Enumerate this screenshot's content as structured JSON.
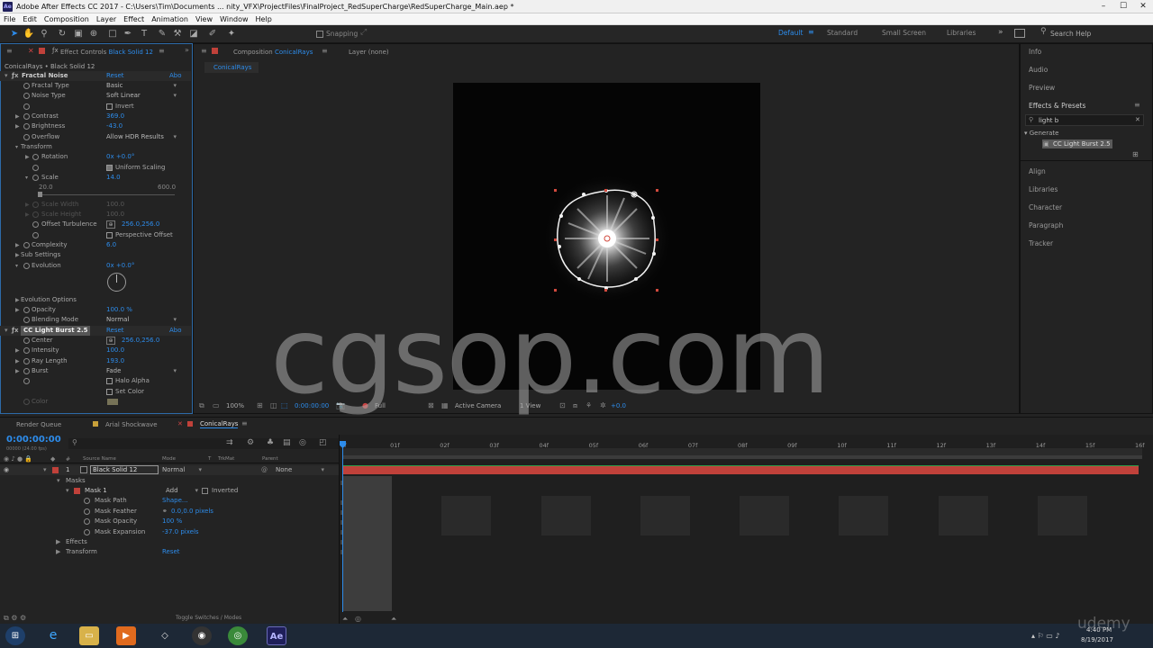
{
  "window": {
    "title": "Adobe After Effects CC 2017 - C:\\Users\\Tim\\Documents ... nity_VFX\\ProjectFiles\\FinalProject_RedSuperCharge\\RedSuperCharge_Main.aep *"
  },
  "menu": [
    "File",
    "Edit",
    "Composition",
    "Layer",
    "Effect",
    "Animation",
    "View",
    "Window",
    "Help"
  ],
  "toolbar": {
    "snapping": "Snapping",
    "workspaces": [
      "Default",
      "Standard",
      "Small Screen",
      "Libraries"
    ],
    "search_placeholder": "Search Help"
  },
  "effect_controls": {
    "tab": "Effect Controls",
    "tab_layer": "Black Solid 12",
    "breadcrumb": "ConicalRays • Black Solid 12",
    "fractal_noise": {
      "name": "Fractal Noise",
      "reset": "Reset",
      "about": "Abo",
      "fractal_type_label": "Fractal Type",
      "fractal_type": "Basic",
      "noise_type_label": "Noise Type",
      "noise_type": "Soft Linear",
      "invert": "Invert",
      "contrast_label": "Contrast",
      "contrast": "369.0",
      "brightness_label": "Brightness",
      "brightness": "-43.0",
      "overflow_label": "Overflow",
      "overflow": "Allow HDR Results",
      "transform_label": "Transform",
      "rotation_label": "Rotation",
      "rotation": "0x +0.0°",
      "uniform_scaling": "Uniform Scaling",
      "scale_label": "Scale",
      "scale": "14.0",
      "scale_min": "20.0",
      "scale_max": "600.0",
      "scale_width_label": "Scale Width",
      "scale_width": "100.0",
      "scale_height_label": "Scale Height",
      "scale_height": "100.0",
      "offset_label": "Offset Turbulence",
      "offset": "256.0,256.0",
      "perspective_offset": "Perspective Offset",
      "complexity_label": "Complexity",
      "complexity": "6.0",
      "sub_settings_label": "Sub Settings",
      "evolution_label": "Evolution",
      "evolution": "0x +0.0°",
      "evolution_options_label": "Evolution Options",
      "opacity_label": "Opacity",
      "opacity": "100.0 %",
      "blending_label": "Blending Mode",
      "blending": "Normal"
    },
    "light_burst": {
      "name": "CC Light Burst 2.5",
      "reset": "Reset",
      "about": "Abo",
      "center_label": "Center",
      "center": "256.0,256.0",
      "intensity_label": "Intensity",
      "intensity": "100.0",
      "ray_length_label": "Ray Length",
      "ray_length": "193.0",
      "burst_label": "Burst",
      "burst": "Fade",
      "halo_alpha": "Halo Alpha",
      "set_color": "Set Color",
      "color_label": "Color"
    }
  },
  "composition": {
    "tab_prefix": "Composition",
    "tab_name": "ConicalRays",
    "layer_tab": "Layer (none)",
    "sub_tab": "ConicalRays",
    "zoom": "100%",
    "timecode": "0:00:00:00",
    "resolution": "Full",
    "camera": "Active Camera",
    "views": "1 View",
    "exposure": "+0.0"
  },
  "right_panel": {
    "items_top": [
      "Info",
      "Audio",
      "Preview"
    ],
    "effects_presets": "Effects & Presets",
    "search_value": "light b",
    "category": "Generate",
    "result": "CC Light Burst 2.5",
    "items_bottom": [
      "Align",
      "Libraries",
      "Character",
      "Paragraph",
      "Tracker"
    ]
  },
  "timeline": {
    "tabs": [
      "Render Queue",
      "Arial Shockwave",
      "ConicalRays"
    ],
    "timecode": "0:00:00:00",
    "fps": "00000 (24.00 fps)",
    "headers": [
      "Source Name",
      "Mode",
      "T",
      "TrkMat",
      "Parent"
    ],
    "layer": {
      "index": "1",
      "name": "Black Solid 12",
      "mode": "Normal",
      "parent": "None"
    },
    "masks_label": "Masks",
    "mask1": {
      "name": "Mask 1",
      "mode": "Add",
      "inverted": "Inverted"
    },
    "mask_path_label": "Mask Path",
    "mask_path": "Shape...",
    "mask_feather_label": "Mask Feather",
    "mask_feather": "0.0,0.0 pixels",
    "mask_opacity_label": "Mask Opacity",
    "mask_opacity": "100 %",
    "mask_expansion_label": "Mask Expansion",
    "mask_expansion": "-37.0 pixels",
    "effects_label": "Effects",
    "transform_label": "Transform",
    "transform_reset": "Reset",
    "ruler": [
      "0f",
      "01f",
      "02f",
      "03f",
      "04f",
      "05f",
      "06f",
      "07f",
      "08f",
      "09f",
      "10f",
      "11f",
      "12f",
      "13f",
      "14f",
      "15f",
      "16f"
    ],
    "toggle_label": "Toggle Switches / Modes"
  },
  "taskbar": {
    "time": "4:40 PM",
    "date": "8/19/2017"
  },
  "watermark": "cgsop.com",
  "brand_watermark": "udemy",
  "colors": {
    "accent": "#2d8ceb",
    "layer_bar": "#c0413a",
    "label_red": "#e0453a"
  }
}
